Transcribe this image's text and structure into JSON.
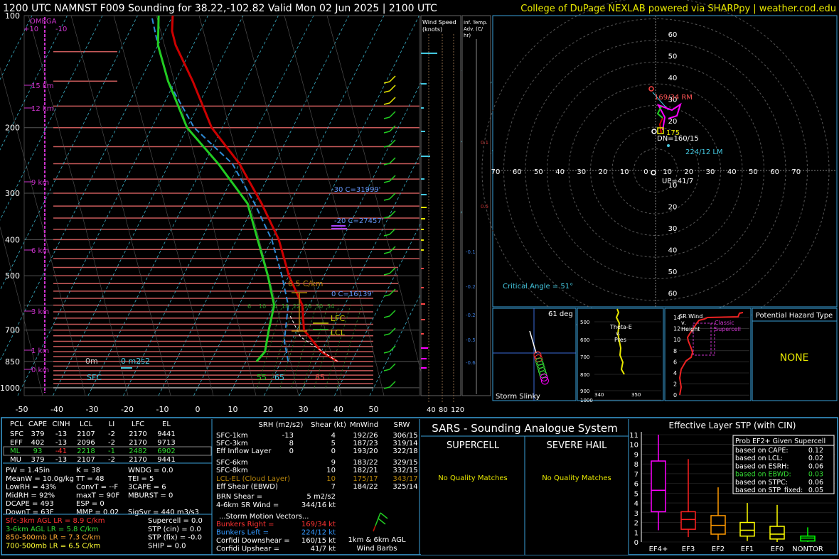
{
  "header": {
    "title": "1200 UTC NAMNST F009 Sounding for 38.22,-102.82 Valid  Mon 02 Jun 2025 | 2100 UTC",
    "credit": "College of DuPage NEXLAB powered via SHARPpy | weather.cod.edu"
  },
  "colors": {
    "background": "#000000",
    "temperature": "#cc0000",
    "dewpoint": "#22cc22",
    "wetbulb": "#2e8bd6",
    "isobar_levels": "#c85a5a",
    "panel_border": "#3aa0d8",
    "hodo_rings": "#555555",
    "cyan_text": "#44c8e0",
    "yellow_text": "#e8e800",
    "magenta": "#ff00ff"
  },
  "skewt": {
    "pressure_ticks": [
      "100",
      "200",
      "300",
      "400",
      "500",
      "700",
      "850",
      "1000"
    ],
    "temp_ticks": [
      "-50",
      "-40",
      "-30",
      "-20",
      "-10",
      "0",
      "10",
      "20",
      "30",
      "40",
      "50"
    ],
    "height_labels": [
      "15 km",
      "12 km",
      "9 km",
      "6 km",
      "3 km",
      "1 km",
      "0 km"
    ],
    "omega_label": "OMEGA",
    "omega_scale": "+10",
    "omega_scale_neg": "-10",
    "isotherm_labels": [
      {
        "text": "-30 C=31999'",
        "color": "#6699ff"
      },
      {
        "text": "-20 C=27457'",
        "color": "#6699ff"
      },
      {
        "text": "0 C=16139'",
        "color": "#6699ff"
      }
    ],
    "lapse_label": "6.5 C/km",
    "lfc_label": "LFC",
    "lcl_label": "LCL",
    "sfc_label": "SFC",
    "mixing_labels": [
      "6",
      "10",
      "14",
      "18",
      "22",
      "26",
      "30",
      "34"
    ],
    "bottom_labels": {
      "dewpoint": "55",
      "wetbulb": "65",
      "temperature": "85"
    },
    "helicity_labels": [
      "0m",
      "0 m2s2"
    ]
  },
  "wind_speed_panel": {
    "title": "Wind Speed (knots)",
    "ticks": [
      "40",
      "80",
      "120"
    ]
  },
  "inferred_temp_panel": {
    "title": "Inf. Temp. Adv. (C/hr)",
    "values": [
      "0.1",
      "0.5",
      "-0.1",
      "-0.2",
      "-0.2",
      "-0.5",
      "-0.6"
    ]
  },
  "hodograph": {
    "ring_labels": [
      "10",
      "20",
      "30",
      "40",
      "50",
      "60"
    ],
    "x_axis_labels": [
      "70",
      "60",
      "50",
      "40",
      "30",
      "20",
      "10",
      "0",
      "10",
      "20",
      "30",
      "40",
      "50",
      "60",
      "70"
    ],
    "y_axis_labels_top": [
      "60",
      "50",
      "40",
      "30",
      "20"
    ],
    "y_axis_labels_bottom": [
      "10",
      "20",
      "30",
      "40",
      "50",
      "60"
    ],
    "rm_label": "169/34 RM",
    "lm_label": "224/12 LM",
    "dn_label": "DN=160/15",
    "up_label": "UP=41/7",
    "mean_wind_label": "175",
    "critical_angle": "Critical Angle = 51°"
  },
  "storm_slinky": {
    "title": "Storm Slinky",
    "angle": "61 deg"
  },
  "theta_panel": {
    "title": "Theta-E v. Pres",
    "y_ticks": [
      "500",
      "600",
      "700",
      "800",
      "900",
      "1000"
    ],
    "x_ticks": [
      "340",
      "350"
    ]
  },
  "sr_wind_panel": {
    "title": "SR Wind v. Height",
    "y_ticks": [
      "14",
      "12",
      "10",
      "8",
      "6",
      "4",
      "2",
      "0"
    ],
    "annotation": "Classic Supercell"
  },
  "hazard_panel": {
    "title": "Potential Hazard Type",
    "value": "NONE"
  },
  "parcel_table": {
    "headers": [
      "PCL",
      "CAPE",
      "CINH",
      "LCL",
      "LI",
      "LFC",
      "EL"
    ],
    "rows": [
      [
        "SFC",
        "379",
        "-13",
        "2107",
        "-2",
        "2170",
        "9441"
      ],
      [
        "EFF",
        "402",
        "-13",
        "2096",
        "-2",
        "2170",
        "9713"
      ],
      [
        "ML",
        "93",
        "-41",
        "2218",
        "-1",
        "2482",
        "6902"
      ],
      [
        "MU",
        "379",
        "-13",
        "2107",
        "-2",
        "2170",
        "9441"
      ]
    ]
  },
  "indices": {
    "col1": [
      "PW = 1.45in",
      "MeanW = 10.0g/kg",
      "LowRH = 43%",
      "MidRH = 92%",
      "DCAPE = 493",
      "DownT = 63F"
    ],
    "col2": [
      "K = 38",
      "TT = 48",
      "ConvT = --F",
      "maxT = 90F",
      "ESP = 0",
      "MMP = 0.02"
    ],
    "col3": [
      "WNDG = 0.0",
      "TEI = 5",
      "3CAPE = 6",
      "MBURST = 0",
      "",
      "SigSvr = 440 m3/s3"
    ]
  },
  "lapse_rates": [
    {
      "text": "Sfc-3km AGL LR = 8.9 C/km",
      "color": "#ff3333"
    },
    {
      "text": "3-6km AGL LR = 5.8 C/km",
      "color": "#33dd33"
    },
    {
      "text": "850-500mb LR = 7.3 C/km",
      "color": "#ffaa33"
    },
    {
      "text": "700-500mb LR = 6.5 C/km",
      "color": "#ffff33"
    }
  ],
  "composite_params": [
    "Supercell = 0.0",
    "STP (cin) = 0.0",
    "STP (fix) = -0.0",
    "SHIP = 0.0"
  ],
  "kinematics": {
    "headers": [
      "SRH (m2/s2)",
      "Shear (kt)",
      "MnWind",
      "SRW"
    ],
    "rows": [
      {
        "label": "SFC-1km",
        "srh": "-13",
        "shear": "4",
        "mnwind": "192/26",
        "srw": "306/15",
        "color": "#ffffff"
      },
      {
        "label": "SFC-3km",
        "srh": "8",
        "shear": "5",
        "mnwind": "187/23",
        "srw": "319/14",
        "color": "#ffffff"
      },
      {
        "label": "Eff Inflow Layer",
        "srh": "0",
        "shear": "0",
        "mnwind": "193/20",
        "srw": "322/18",
        "color": "#ffffff"
      },
      {
        "label": "SFC-6km",
        "srh": "",
        "shear": "9",
        "mnwind": "183/22",
        "srw": "329/15",
        "color": "#ffffff"
      },
      {
        "label": "SFC-8km",
        "srh": "",
        "shear": "10",
        "mnwind": "182/21",
        "srw": "332/15",
        "color": "#ffffff"
      },
      {
        "label": "LCL-EL (Cloud Layer)",
        "srh": "",
        "shear": "10",
        "mnwind": "175/17",
        "srw": "343/17",
        "color": "#b8860b"
      },
      {
        "label": "Eff Shear (EBWD)",
        "srh": "",
        "shear": "7",
        "mnwind": "184/22",
        "srw": "325/14",
        "color": "#ffffff"
      }
    ],
    "brn_shear": "BRN Shear =",
    "brn_shear_value": "5 m2/s2",
    "sr_wind_4_6": "4-6km SR Wind =",
    "sr_wind_4_6_value": "344/16 kt",
    "storm_motion_title": "...Storm Motion Vectors...",
    "storm_motion": [
      {
        "label": "Bunkers Right =",
        "value": "169/34 kt",
        "color": "#ff3333"
      },
      {
        "label": "Bunkers Left =",
        "value": "224/12 kt",
        "color": "#3399ff"
      },
      {
        "label": "Corfidi Downshear =",
        "value": "160/15 kt",
        "color": "#ffffff"
      },
      {
        "label": "Corfidi Upshear =",
        "value": "41/7 kt",
        "color": "#ffffff"
      }
    ],
    "barb_caption": "1km & 6km AGL Wind Barbs"
  },
  "sars": {
    "title": "SARS - Sounding Analogue System",
    "supercell": "SUPERCELL",
    "hail": "SEVERE HAIL",
    "supercell_result": "No Quality Matches",
    "hail_result": "No Quality Matches"
  },
  "stp_panel": {
    "title": "Effective Layer STP (with CIN)",
    "legend_title": "Prob EF2+ Given Supercell",
    "legend": [
      {
        "label": "based on CAPE:",
        "value": "0.12",
        "color": "#ffffff"
      },
      {
        "label": "based on LCL:",
        "value": "0.02",
        "color": "#ffffff"
      },
      {
        "label": "based on ESRH:",
        "value": "0.06",
        "color": "#ffffff"
      },
      {
        "label": "based on EBWD:",
        "value": "0.03",
        "color": "#33dd33"
      },
      {
        "label": "based on STPC:",
        "value": "0.06",
        "color": "#ffffff"
      },
      {
        "label": "based on STP_fixed:",
        "value": "0.05",
        "color": "#ffffff"
      }
    ]
  },
  "chart_data": [
    {
      "type": "line",
      "title": "1200 UTC NAMNST F009 Sounding for 38.22,-102.82",
      "xlabel": "",
      "ylabel": "",
      "xlim": [
        -50,
        50
      ],
      "ylim": [
        1000,
        100
      ],
      "series": [
        {
          "name": "",
          "color": "#cc0000",
          "points": [
            [
              36,
              850
            ],
            [
              30,
              800
            ],
            [
              22,
              700
            ],
            [
              18,
              600
            ],
            [
              10,
              500
            ],
            [
              2,
              400
            ],
            [
              -8,
              320
            ],
            [
              -20,
              250
            ],
            [
              -33,
              200
            ],
            [
              -45,
              150
            ],
            [
              -55,
              120
            ],
            [
              -58,
              110
            ],
            [
              -60,
              100
            ]
          ]
        },
        {
          "name": "",
          "color": "#22cc22",
          "points": [
            [
              13,
              850
            ],
            [
              14,
              800
            ],
            [
              12,
              700
            ],
            [
              10,
              600
            ],
            [
              4,
              500
            ],
            [
              -4,
              400
            ],
            [
              -12,
              320
            ],
            [
              -26,
              250
            ],
            [
              -40,
              200
            ],
            [
              -52,
              150
            ],
            [
              -60,
              120
            ],
            [
              -64,
              100
            ]
          ]
        },
        {
          "name": "",
          "color": "#2e8bd6",
          "points": [
            [
              22,
              850
            ],
            [
              18,
              750
            ],
            [
              14,
              600
            ],
            [
              8,
              500
            ],
            [
              0,
              400
            ],
            [
              -10,
              320
            ],
            [
              -22,
              250
            ],
            [
              -38,
              200
            ],
            [
              -52,
              150
            ],
            [
              -60,
              120
            ],
            [
              -66,
              100
            ]
          ]
        }
      ]
    },
    {
      "type": "box",
      "title": "Effective Layer STP (with CIN)",
      "categories": [
        "EF4+",
        "EF3",
        "EF2",
        "EF1",
        "EF0",
        "NONTOR"
      ],
      "ylim": [
        0,
        11
      ],
      "yticks": [
        "0",
        "1",
        "2",
        "3",
        "4",
        "5",
        "6",
        "7",
        "8",
        "9",
        "10",
        "11"
      ],
      "boxes": [
        {
          "min": 1.2,
          "q1": 3.1,
          "median": 5.3,
          "q3": 8.3,
          "max": 11.0,
          "color": "#ff00ff"
        },
        {
          "min": 0.5,
          "q1": 1.3,
          "median": 2.3,
          "q3": 3.1,
          "max": 8.5,
          "color": "#ff2020"
        },
        {
          "min": 0.2,
          "q1": 0.8,
          "median": 1.7,
          "q3": 2.7,
          "max": 5.6,
          "color": "#ff9900"
        },
        {
          "min": 0.1,
          "q1": 0.6,
          "median": 1.2,
          "q3": 2.0,
          "max": 4.0,
          "color": "#ffff00"
        },
        {
          "min": 0.0,
          "q1": 0.3,
          "median": 0.8,
          "q3": 1.6,
          "max": 3.8,
          "color": "#ffff00"
        },
        {
          "min": 0.0,
          "q1": 0.1,
          "median": 0.4,
          "q3": 0.6,
          "max": 1.5,
          "color": "#00ff00"
        }
      ]
    }
  ]
}
